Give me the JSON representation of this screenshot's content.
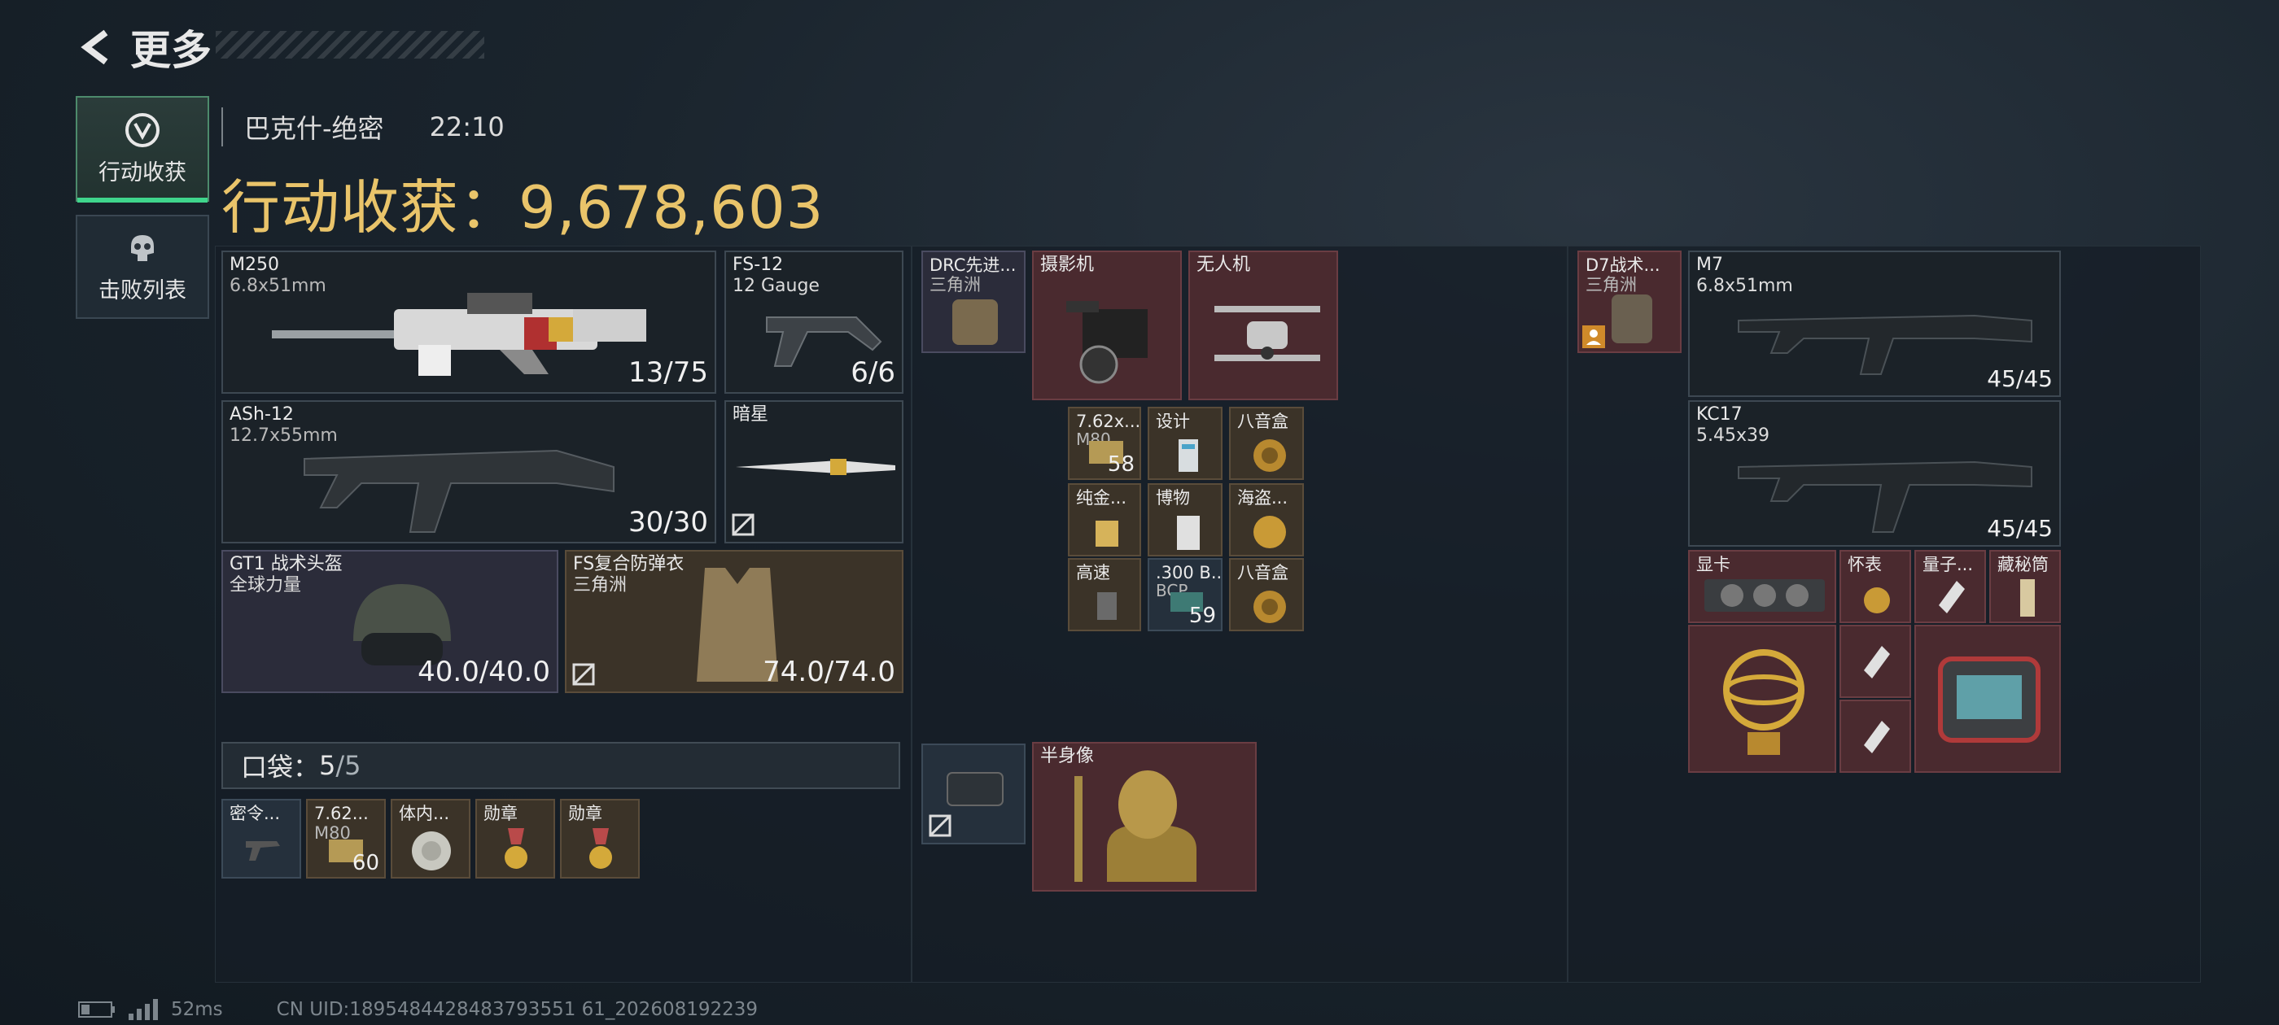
{
  "header": {
    "title": "更多"
  },
  "tabs": [
    {
      "label": "行动收获",
      "icon": "helmet-emblem-icon",
      "active": true
    },
    {
      "label": "击败列表",
      "icon": "skull-icon",
      "active": false
    }
  ],
  "summary": {
    "map": "巴克什-绝密",
    "time": "22:10",
    "gain_label": "行动收获：",
    "gain_value": "9,678,603"
  },
  "loadout": {
    "m250": {
      "name": "M250",
      "ammo": "6.8x51mm",
      "count": "13/75"
    },
    "fs12": {
      "name": "FS-12",
      "ammo": "12 Gauge",
      "count": "6/6"
    },
    "ash12": {
      "name": "ASh-12",
      "ammo": "12.7x55mm",
      "count": "30/30"
    },
    "knife": {
      "name": "暗星"
    },
    "helmet": {
      "name": "GT1 战术头盔",
      "brand": "全球力量",
      "durability": "40.0/40.0"
    },
    "armor": {
      "name": "FS复合防弹衣",
      "brand": "三角洲",
      "durability": "74.0/74.0"
    }
  },
  "pocket": {
    "label": "口袋：",
    "used": "5",
    "total": "/5",
    "items": [
      {
        "name": "密令..."
      },
      {
        "name": "7.62...",
        "sub": "M80",
        "count": "60"
      },
      {
        "name": "体内..."
      },
      {
        "name": "勋章"
      },
      {
        "name": "勋章"
      }
    ]
  },
  "backpack": {
    "rig": {
      "name": "DRC先进...",
      "brand": "三角洲"
    },
    "camera": {
      "name": "摄影机"
    },
    "drone": {
      "name": "无人机"
    },
    "grid": [
      {
        "name": "7.62x...",
        "sub": "M80",
        "count": "58"
      },
      {
        "name": "设计"
      },
      {
        "name": "八音盒"
      },
      {
        "name": "纯金..."
      },
      {
        "name": "博物"
      },
      {
        "name": "海盗..."
      },
      {
        "name": "高速"
      },
      {
        "name": ".300 B...",
        "sub": "BCP...",
        "count": "59"
      },
      {
        "name": "八音盒"
      }
    ],
    "bust": {
      "name": "半身像"
    }
  },
  "right": {
    "rig": {
      "name": "D7战术...",
      "brand": "三角洲"
    },
    "m7": {
      "name": "M7",
      "ammo": "6.8x51mm",
      "count": "45/45"
    },
    "kc17": {
      "name": "KC17",
      "ammo": "5.45x39",
      "count": "45/45"
    },
    "small": [
      {
        "name": "显卡"
      },
      {
        "name": "怀表"
      },
      {
        "name": "量子..."
      },
      {
        "name": "藏秘筒"
      }
    ]
  },
  "footer": {
    "ping": "52ms",
    "uid": "CN UID:1895484428483793551 61_202608192239"
  },
  "colors": {
    "gold": "#e9c46a",
    "active_tab": "#3fd58c",
    "red_rarity": "#4a2a2f",
    "gold_rarity": "#3b3328",
    "purple_rarity": "#2b2c3a"
  }
}
